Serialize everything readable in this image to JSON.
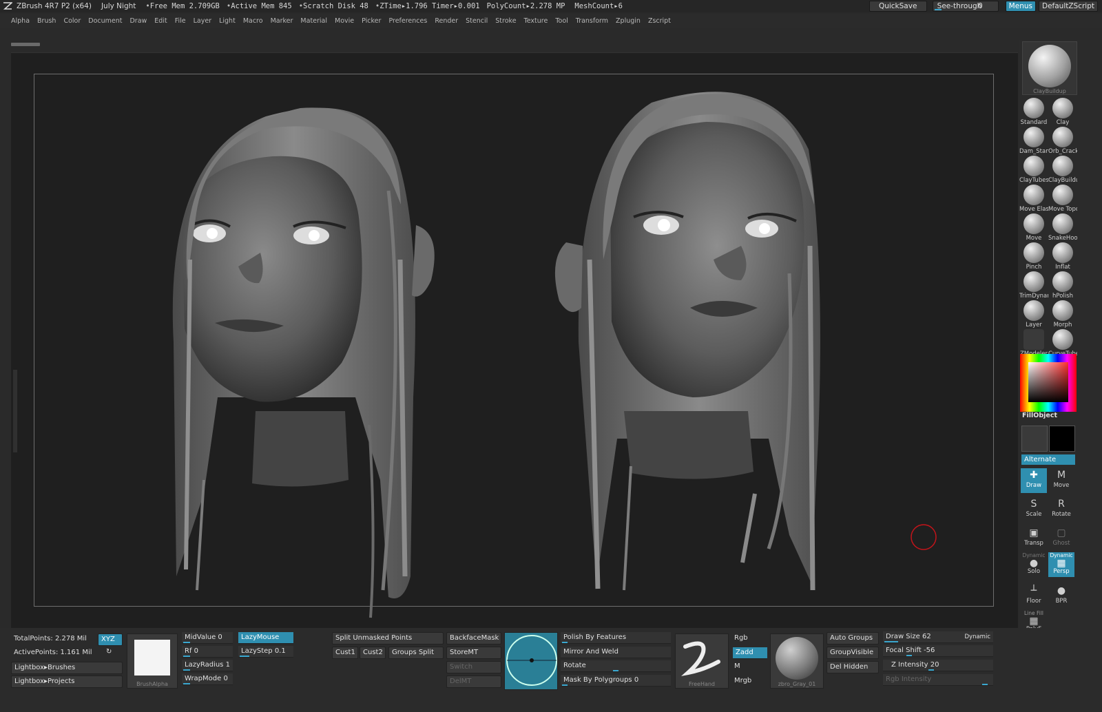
{
  "titlebar": {
    "app": "ZBrush 4R7 P2 (x64)",
    "doc": "July Night",
    "stats": [
      "Free Mem 2.709GB",
      "Active Mem 845",
      "Scratch Disk 48",
      "ZTime▸1.796 Timer▸0.001",
      "PolyCount▸2.278 MP",
      "MeshCount▸6"
    ],
    "quicksave": "QuickSave",
    "seethrough": "See-through",
    "seethrough_value": "0",
    "menus": "Menus",
    "script": "DefaultZScript"
  },
  "menubar": [
    "Alpha",
    "Brush",
    "Color",
    "Document",
    "Draw",
    "Edit",
    "File",
    "Layer",
    "Light",
    "Macro",
    "Marker",
    "Material",
    "Movie",
    "Picker",
    "Preferences",
    "Render",
    "Stencil",
    "Stroke",
    "Texture",
    "Tool",
    "Transform",
    "Zplugin",
    "Zscript"
  ],
  "rightpanel": {
    "current_brush": "ClayBuildup",
    "brushes": [
      "Standard",
      "Clay",
      "Dam_Standard",
      "Orb_Cracks",
      "ClayTubes",
      "ClayBuildup",
      "Move Elastic",
      "Move Topological",
      "Move",
      "SnakeHook",
      "Pinch",
      "Inflat",
      "TrimDynamic",
      "hPolish",
      "Layer",
      "Morph",
      "ZModeler",
      "CurveTube"
    ],
    "fillobject": "FillObject",
    "alternate": "Alternate",
    "tools": {
      "draw": "Draw",
      "move": "Move",
      "scale": "Scale",
      "rotate": "Rotate",
      "transp": "Transp",
      "ghost": "Ghost",
      "dynamic_label": "Dynamic",
      "solo": "Solo",
      "dynamic_label2": "Dynamic",
      "persp": "Persp",
      "floor": "Floor",
      "bpr": "BPR",
      "linefill": "Line Fill",
      "polyf": "PolyF"
    },
    "colors": {
      "accent": "#2f8fb0",
      "primary": "#3a3a3a",
      "secondary": "#000000"
    }
  },
  "bottom": {
    "total_points": "TotalPoints: 2.278 Mil",
    "active_points": "ActivePoints: 1.161 Mil",
    "xyz": "XYZ",
    "lightbox_brushes": "Lightbox▸Brushes",
    "lightbox_projects": "Lightbox▸Projects",
    "brush_alpha": "BrushAlpha",
    "midvalue": "MidValue 0",
    "rf": "Rf 0",
    "lazyradius": "LazyRadius 1",
    "wrapmode": "WrapMode 0",
    "lazymouse": "LazyMouse",
    "lazystep": "LazyStep 0.1",
    "split_unmasked": "Split Unmasked Points",
    "cust1": "Cust1",
    "cust2": "Cust2",
    "groups_split": "Groups Split",
    "backfacemask": "BackfaceMask",
    "storemt": "StoreMT",
    "switch": "Switch",
    "delmt": "DelMT",
    "polish_features": "Polish By Features",
    "mirror_weld": "Mirror And Weld",
    "rotate": "Rotate",
    "mask_polygroups": "Mask By Polygroups 0",
    "stroke": "FreeHand",
    "rgb": "Rgb",
    "zadd": "Zadd",
    "m": "M",
    "mrgb": "Mrgb",
    "material": "zbro_Gray_01",
    "auto_groups": "Auto Groups",
    "group_visible": "GroupVisible",
    "del_hidden": "Del Hidden",
    "draw_size": "Draw Size 62",
    "dynamic": "Dynamic",
    "focal_shift": "Focal Shift -56",
    "z_intensity": "Z Intensity 20",
    "rgb_intensity": "Rgb Intensity"
  }
}
